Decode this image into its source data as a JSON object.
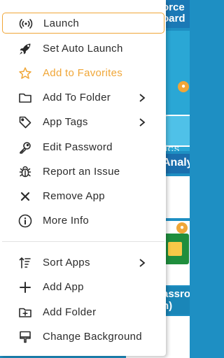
{
  "menu": {
    "items": [
      {
        "label": "Launch"
      },
      {
        "label": "Set Auto Launch"
      },
      {
        "label": "Add to Favorites"
      },
      {
        "label": "Add To Folder"
      },
      {
        "label": "App Tags"
      },
      {
        "label": "Edit Password"
      },
      {
        "label": "Report an Issue"
      },
      {
        "label": "Remove App"
      },
      {
        "label": "More Info"
      },
      {
        "label": "Sort Apps"
      },
      {
        "label": "Add App"
      },
      {
        "label": "Add Folder"
      },
      {
        "label": "Change Background"
      }
    ]
  },
  "background": {
    "tile1_line1": "orce",
    "tile1_line2": "oard",
    "tile2_caption": "TICS",
    "tile3_title": "Analy",
    "tile6_line1": "assro",
    "tile6_line2": "n)"
  },
  "colors": {
    "accent": "#f0a637",
    "menu_text": "#2b2b2b",
    "backdrop": "#1e8fc3"
  }
}
